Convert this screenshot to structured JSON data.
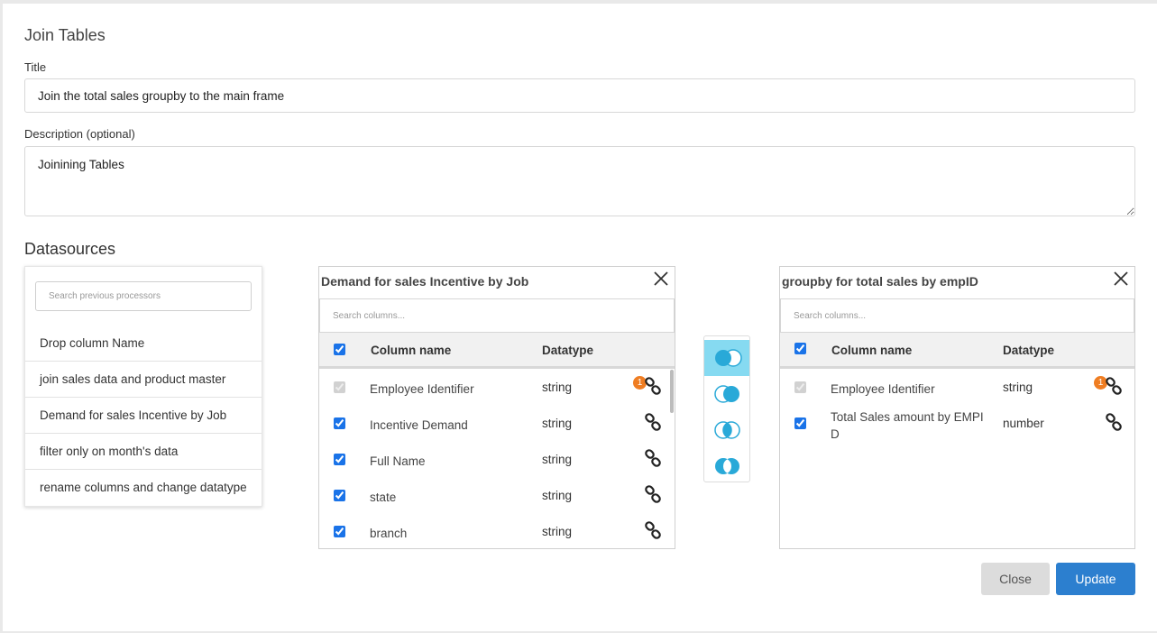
{
  "dialog": {
    "title": "Join Tables"
  },
  "form": {
    "title_label": "Title",
    "title_value": "Join the total sales groupby to the main frame",
    "description_label": "Description (optional)",
    "description_value": "Joinining Tables"
  },
  "datasources": {
    "heading": "Datasources",
    "search_placeholder": "Search previous processors",
    "processors": [
      "Drop column Name",
      "join sales data and product master",
      "Demand for sales Incentive by Job",
      "filter only on month's data",
      "rename columns and change datatype"
    ]
  },
  "left_table": {
    "title": "Demand for sales Incentive by Job",
    "search_placeholder": "Search columns...",
    "header": {
      "name": "Column name",
      "type": "Datatype"
    },
    "rows": [
      {
        "name": "Employee Identifier",
        "type": "string",
        "badge": "1"
      },
      {
        "name": "Incentive Demand",
        "type": "string"
      },
      {
        "name": "Full Name",
        "type": "string"
      },
      {
        "name": "state",
        "type": "string"
      },
      {
        "name": "branch",
        "type": "string"
      }
    ]
  },
  "right_table": {
    "title": "groupby for total sales by empID",
    "search_placeholder": "Search columns...",
    "header": {
      "name": "Column name",
      "type": "Datatype"
    },
    "rows": [
      {
        "name": "Employee Identifier",
        "type": "string",
        "badge": "1"
      },
      {
        "name": "Total Sales amount by EMPID",
        "type": "number"
      }
    ]
  },
  "join_types": [
    "left-join-icon",
    "right-join-icon",
    "inner-join-icon",
    "outer-join-icon"
  ],
  "buttons": {
    "close": "Close",
    "update": "Update"
  },
  "colors": {
    "accent": "#2c7fcf",
    "join_blue": "#29a9d8",
    "join_active_bg": "#86daf1",
    "badge": "#ef7d22"
  }
}
